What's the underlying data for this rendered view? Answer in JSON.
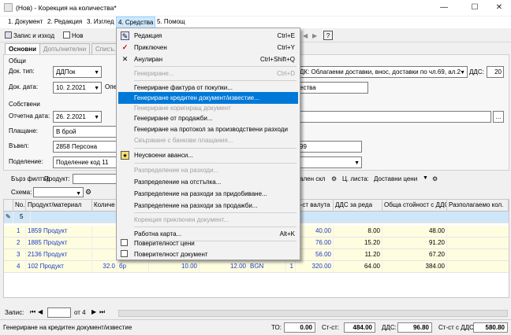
{
  "window": {
    "title": "(Нов) - Корекция на количества*",
    "min": "—",
    "max": "☐",
    "close": "✕"
  },
  "menubar": [
    "1. Документ",
    "2. Редакция",
    "3. Изглед",
    "4. Средства",
    "5. Помощ"
  ],
  "toolbar": {
    "save_exit": "Запис и изход",
    "new": "Нов"
  },
  "tabs": [
    "Основни",
    "Допълнителни",
    "Списъ..."
  ],
  "form": {
    "section_general": "Общи",
    "doc_type_label": "Док. тип:",
    "doc_type_value": "ДДПок",
    "doc_date_label": "Док. дата:",
    "doc_date_value": "10. 2.2021",
    "op_label": "Опе",
    "vat_value": "ДК: Облагаеми доставки, внос, доставки по чл.69, ал.2",
    "vat_label": "ДДС:",
    "vat_rate": "20",
    "op_value": "ества",
    "section_own": "Собствени",
    "report_date_label": "Отчетна дата:",
    "report_date_value": "26. 2.2021",
    "payment_label": "Плащане:",
    "payment_value": "В брой",
    "entered_label": "Въвел:",
    "entered_value": "2858 Персона",
    "entered_extra": "99",
    "dept_label": "Поделение:",
    "dept_value": "Поделение код 11",
    "ellipsis": "..."
  },
  "gridtop": {
    "quick_filter": "Бърз филтър",
    "product_label": "Продукт:",
    "scheme_label": "Схема:",
    "store_value": "ален скл",
    "price_list_label": "Ц. листа:",
    "price_list_value": "Доставни цени"
  },
  "grid": {
    "headers": [
      "No.",
      "Продукт/материал",
      "Количе",
      "т-ст валута",
      "ДДС за реда",
      "Обща стойност с ДДС",
      "Разполагаемо кол."
    ],
    "first_row_no": "5",
    "rows": [
      {
        "no": "1",
        "product": "1859 Продукт",
        "sum": "40.00",
        "vat": "8.00",
        "total": "48.00"
      },
      {
        "no": "2",
        "product": "1885 Продукт",
        "sum": "76.00",
        "vat": "15.20",
        "total": "91.20"
      },
      {
        "no": "3",
        "product": "2136 Продукт",
        "sum": "56.00",
        "vat": "11.20",
        "total": "67.20"
      },
      {
        "no": "4",
        "product": "102 Продукт",
        "qty": "32.0",
        "unit": "бр",
        "price": "10.00",
        "price2": "12.00",
        "cur": "BGN",
        "rate": "1",
        "sum": "320.00",
        "vat": "64.00",
        "total": "384.00"
      }
    ]
  },
  "nav": {
    "label": "Запис:",
    "of": "от 4"
  },
  "status": {
    "text": "Генериране на кредитен документ/известие",
    "to_label": "ТО:",
    "to_value": "0.00",
    "sum_label": "Ст-ст:",
    "sum_value": "484.00",
    "vat_label": "ДДС:",
    "vat_value": "96.80",
    "total_label": "Ст-ст с ДДС:",
    "total_value": "580.80"
  },
  "menu": [
    {
      "label": "Редакция",
      "key": "Ctrl+E",
      "icon": "edit-icon",
      "state": "normal"
    },
    {
      "label": "Приключен",
      "key": "Ctrl+Y",
      "icon": "check-icon",
      "state": "normal"
    },
    {
      "label": "Анулиран",
      "key": "Ctrl+Shift+Q",
      "icon": "cross-icon",
      "state": "normal"
    },
    {
      "label": "Генериране...",
      "key": "Ctrl+D",
      "icon": "",
      "state": "disabled"
    },
    {
      "label": "Генериране фактура от покупки...",
      "key": "",
      "icon": "",
      "state": "normal"
    },
    {
      "label": "Генериране кредитен документ/известие...",
      "key": "",
      "icon": "",
      "state": "highlight"
    },
    {
      "label": "Генериране коригиращ документ",
      "key": "",
      "icon": "",
      "state": "disabled"
    },
    {
      "label": "Генериране от продажби...",
      "key": "",
      "icon": "",
      "state": "normal"
    },
    {
      "label": "Генериране на протокол за производствени разходи",
      "key": "",
      "icon": "",
      "state": "normal"
    },
    {
      "label": "Свързване с банкови плащания...",
      "key": "",
      "icon": "",
      "state": "disabled"
    },
    {
      "label": "Неусвоени аванси...",
      "key": "",
      "icon": "star-icon",
      "state": "normal"
    },
    {
      "label": "Разпределение на разходи...",
      "key": "",
      "icon": "",
      "state": "disabled"
    },
    {
      "label": "Разпределение на отстъпка...",
      "key": "",
      "icon": "",
      "state": "normal"
    },
    {
      "label": "Разпределение на разходи за придобиване...",
      "key": "",
      "icon": "",
      "state": "normal"
    },
    {
      "label": "Разпределение на разходи за продажби...",
      "key": "",
      "icon": "",
      "state": "normal"
    },
    {
      "label": "Корекция приключен документ...",
      "key": "",
      "icon": "",
      "state": "disabled"
    },
    {
      "label": "Работна карта...",
      "key": "Alt+K",
      "icon": "",
      "state": "normal"
    },
    {
      "label": "Поверителност цени",
      "key": "",
      "icon": "checkbox-icon",
      "state": "normal"
    },
    {
      "label": "Поверителност документ",
      "key": "",
      "icon": "checkbox-icon",
      "state": "normal"
    }
  ],
  "colors": {
    "highlight": "#0078d7",
    "link": "#1a3cc8",
    "row_bg": "#fffde0",
    "row_sel": "#cfe6f8"
  }
}
